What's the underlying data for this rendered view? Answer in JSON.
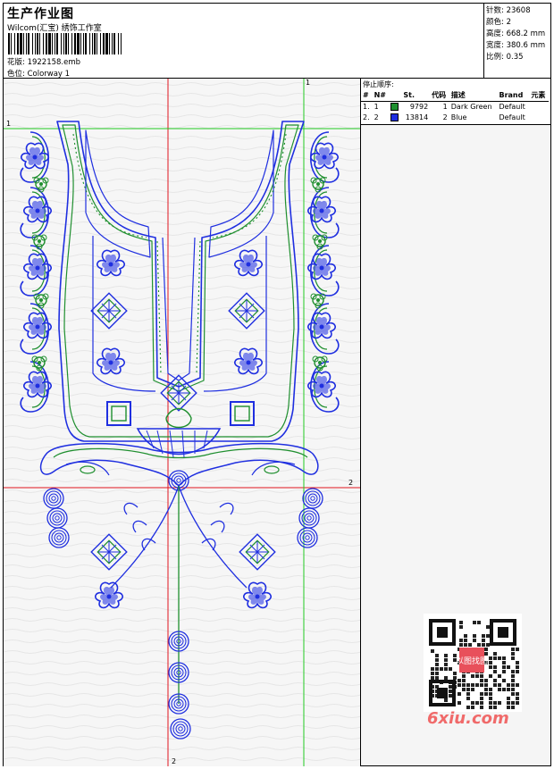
{
  "header": {
    "title": "生产作业图",
    "company": "Wilcom(汇宝) 绣饰工作室",
    "design_label": "花版:",
    "design_value": "1922158.emb",
    "colorway_label": "色位:",
    "colorway_value": "Colorway 1"
  },
  "stats": [
    {
      "label": "针数:",
      "value": "23608"
    },
    {
      "label": "颜色:",
      "value": "2"
    },
    {
      "label": "高度:",
      "value": "668.2 mm"
    },
    {
      "label": "宽度:",
      "value": "380.6 mm"
    },
    {
      "label": "比例:",
      "value": "0.35"
    }
  ],
  "stop_sequence": {
    "title": "停止顺序:",
    "columns": [
      "#",
      "N#",
      "St.",
      "代码",
      "描述",
      "Brand",
      "元素"
    ],
    "rows": [
      {
        "num": "1.",
        "n": "1",
        "color": "#1f8f2f",
        "st": "9792",
        "code": "1",
        "desc": "Dark Green",
        "brand": "Default"
      },
      {
        "num": "2.",
        "n": "2",
        "color": "#1f2fe0",
        "st": "13814",
        "code": "2",
        "desc": "Blue",
        "brand": "Default"
      }
    ]
  },
  "guides": {
    "top_label": "1",
    "left_label": "1",
    "right_label": "2",
    "bottom_label": "2"
  },
  "watermark": {
    "text": "6xiu.com",
    "qr_text": "以图找图"
  },
  "colors": {
    "green": "#1f8f2f",
    "blue": "#1f2fe0",
    "guide_red": "#e0141e",
    "guide_green": "#22c922"
  }
}
